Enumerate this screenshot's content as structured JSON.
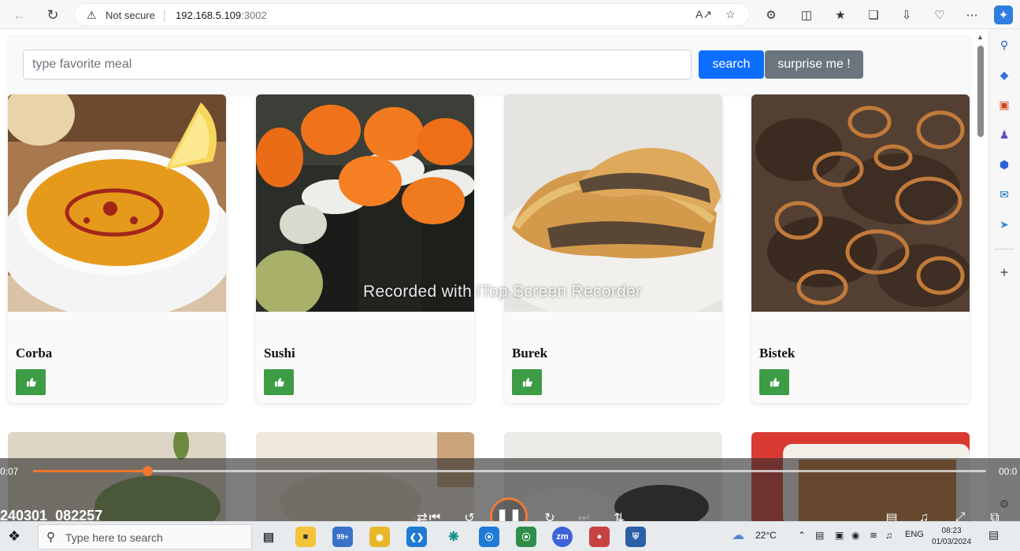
{
  "browser": {
    "security_label": "Not secure",
    "url_host": "192.168.5.109",
    "url_port": ":3002"
  },
  "search": {
    "placeholder": "type favorite meal",
    "search_label": "search",
    "surprise_label": "surprise me !"
  },
  "meals": [
    {
      "title": "Corba"
    },
    {
      "title": "Sushi"
    },
    {
      "title": "Burek"
    },
    {
      "title": "Bistek"
    }
  ],
  "watermark": "Recorded with iTop Screen Recorder",
  "player": {
    "time_elapsed": "0:07",
    "time_total": "00:0",
    "progress_fraction": 0.12,
    "file_name": "240301_082257"
  },
  "taskbar": {
    "search_placeholder": "Type here to search",
    "badge_count": "99+",
    "zoom_label": "zm",
    "weather": "22°C",
    "language": "ENG",
    "time": "08:23",
    "date": "01/03/2024"
  }
}
